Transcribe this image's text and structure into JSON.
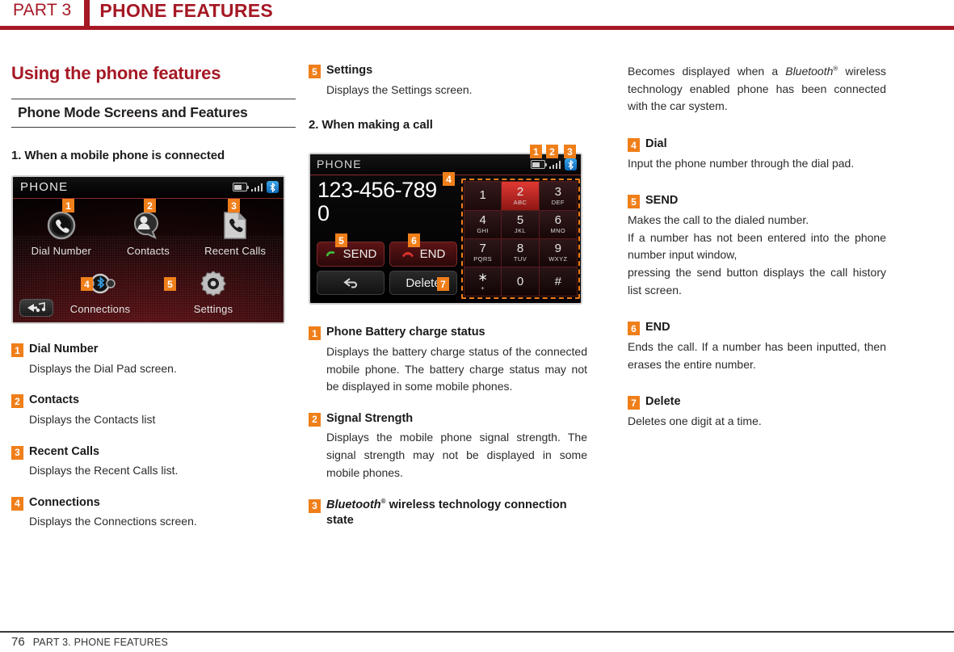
{
  "header": {
    "part": "PART 3",
    "title": "PHONE FEATURES"
  },
  "colors": {
    "brand_red": "#a51824",
    "badge_orange": "#f07f1a",
    "text_dark": "#231f20"
  },
  "left": {
    "page_title": "Using the phone features",
    "section_title": "Phone Mode Screens and Features",
    "sub_heading": "1. When a mobile phone is connected",
    "screen": {
      "title": "PHONE",
      "status_icons": [
        "battery-icon",
        "signal-icon",
        "bluetooth-icon"
      ],
      "tiles": [
        {
          "badge": "1",
          "label": "Dial Number",
          "icon": "phone-handset-icon"
        },
        {
          "badge": "2",
          "label": "Contacts",
          "icon": "contact-person-icon"
        },
        {
          "badge": "3",
          "label": "Recent Calls",
          "icon": "call-log-icon"
        },
        {
          "badge": "4",
          "label": "Connections",
          "icon": "bluetooth-connection-icon"
        },
        {
          "badge": "5",
          "label": "Settings",
          "icon": "gear-icon"
        }
      ],
      "back_button": "back-to-media-icon"
    },
    "entries": [
      {
        "badge": "1",
        "title": "Dial Number",
        "body": "Displays the Dial Pad screen."
      },
      {
        "badge": "2",
        "title": "Contacts",
        "body": "Displays the Contacts list"
      },
      {
        "badge": "3",
        "title": "Recent Calls",
        "body": "Displays the Recent Calls list."
      },
      {
        "badge": "4",
        "title": "Connections",
        "body": "Displays the Connections screen."
      }
    ]
  },
  "mid": {
    "entry_settings": {
      "badge": "5",
      "title": "Settings",
      "body": "Displays the Settings screen."
    },
    "sub_heading": "2. When making a call",
    "screen": {
      "title": "PHONE",
      "dialed_number": "123-456-7890",
      "status_icons": [
        "battery-icon",
        "signal-icon",
        "bluetooth-icon"
      ],
      "badges": {
        "battery": "1",
        "signal": "2",
        "bluetooth": "3",
        "keypad": "4",
        "send": "5",
        "end": "6",
        "delete": "7"
      },
      "buttons": {
        "send": "SEND",
        "end": "END",
        "back": "back-arrow-icon",
        "delete": "Delete"
      },
      "keys": [
        {
          "digit": "1",
          "letters": ""
        },
        {
          "digit": "2",
          "letters": "ABC",
          "highlighted": true
        },
        {
          "digit": "3",
          "letters": "DEF"
        },
        {
          "digit": "4",
          "letters": "GHI"
        },
        {
          "digit": "5",
          "letters": "JKL"
        },
        {
          "digit": "6",
          "letters": "MNO"
        },
        {
          "digit": "7",
          "letters": "PQRS"
        },
        {
          "digit": "8",
          "letters": "TUV"
        },
        {
          "digit": "9",
          "letters": "WXYZ"
        },
        {
          "digit": "∗",
          "letters": "+"
        },
        {
          "digit": "0",
          "letters": ""
        },
        {
          "digit": "#",
          "letters": ""
        }
      ]
    },
    "entries": [
      {
        "badge": "1",
        "title": "Phone Battery charge status",
        "body": "Displays the battery charge status of the connected mobile phone. The battery charge status may not be displayed in some mobile phones."
      },
      {
        "badge": "2",
        "title": "Signal Strength",
        "body": "Displays the mobile phone signal strength. The signal strength may not be displayed in some mobile phones."
      },
      {
        "badge": "3",
        "title_pre": "",
        "title_italic": "Bluetooth",
        "title_sup": "®",
        "title_post": " wireless technology connection state",
        "body": ""
      }
    ]
  },
  "right": {
    "continuation_pre": "Becomes displayed when a ",
    "continuation_italic": "Bluetooth",
    "continuation_sup": "®",
    "continuation_post": " wireless technology enabled phone has been connected with the car system.",
    "entries": [
      {
        "badge": "4",
        "title": "Dial",
        "body": "Input the phone number through the dial pad."
      },
      {
        "badge": "5",
        "title": "SEND",
        "body": "Makes the call to the dialed number.\nIf a number has not been entered into the phone number input window,\npressing the send button displays the call history list screen."
      },
      {
        "badge": "6",
        "title": "END",
        "body": "Ends the call. If a number has been inputted, then erases the entire number."
      },
      {
        "badge": "7",
        "title": "Delete",
        "body": "Deletes one digit at a time."
      }
    ]
  },
  "footer": {
    "page_number": "76",
    "label": "PART 3. PHONE FEATURES"
  }
}
